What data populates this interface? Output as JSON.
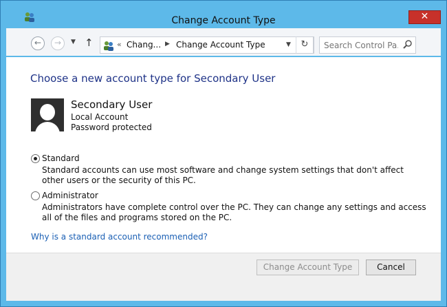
{
  "window": {
    "title": "Change Account Type",
    "close_label": "✕"
  },
  "nav": {
    "back_icon": "←",
    "forward_icon": "→",
    "recent_icon": "▼",
    "up_icon": "↑",
    "breadcrumb_sep": "«",
    "breadcrumb_1": "Chang...",
    "breadcrumb_arrow": "▶",
    "breadcrumb_2": "Change Account Type",
    "dropdown_icon": "▼",
    "refresh_icon": "↻",
    "search_placeholder": "Search Control Pa..."
  },
  "main": {
    "heading": "Choose a new account type for Secondary User",
    "user": {
      "name": "Secondary User",
      "account_type": "Local Account",
      "password_status": "Password protected"
    },
    "options": [
      {
        "label": "Standard",
        "selected": true,
        "description": "Standard accounts can use most software and change system settings that don't affect other users or the security of this PC."
      },
      {
        "label": "Administrator",
        "selected": false,
        "description": "Administrators have complete control over the PC. They can change any settings and access all of the files and programs stored on the PC."
      }
    ],
    "help_link": "Why is a standard account recommended?"
  },
  "footer": {
    "change_button": "Change Account Type",
    "cancel_button": "Cancel"
  },
  "colors": {
    "heading": "#1e3287",
    "link": "#1a5fb4",
    "close_button": "#c7312a",
    "window_frame": "#5db9e9"
  }
}
